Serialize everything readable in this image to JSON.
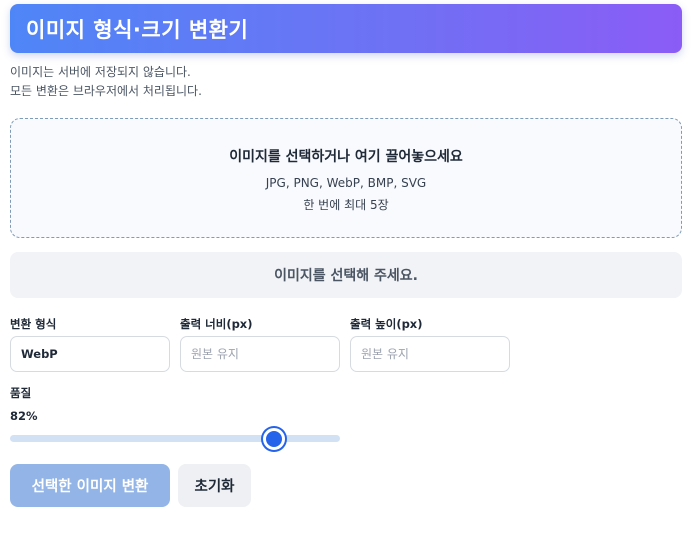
{
  "header": {
    "title": "이미지 형식·크기 변환기"
  },
  "notice": {
    "line1": "이미지는 서버에 저장되지 않습니다.",
    "line2": "모든 변환은 브라우저에서 처리됩니다."
  },
  "dropzone": {
    "title": "이미지를 선택하거나 여기 끌어놓으세요",
    "formats": "JPG, PNG, WebP, BMP, SVG",
    "limit": "한 번에 최대 5장"
  },
  "status": {
    "message": "이미지를 선택해 주세요."
  },
  "form": {
    "format_label": "변환 형식",
    "format_value": "WebP",
    "width_label": "출력 너비(px)",
    "width_placeholder": "원본 유지",
    "height_label": "출력 높이(px)",
    "height_placeholder": "원본 유지",
    "quality_label": "품질",
    "quality_display": "82%",
    "quality_percent": 82
  },
  "buttons": {
    "convert": "선택한 이미지 변환",
    "reset": "초기화"
  },
  "colors": {
    "header_gradient_start": "#4f86f7",
    "header_gradient_end": "#8b5cf6",
    "accent": "#2563eb",
    "primary_button_disabled": "#93b4e6"
  }
}
